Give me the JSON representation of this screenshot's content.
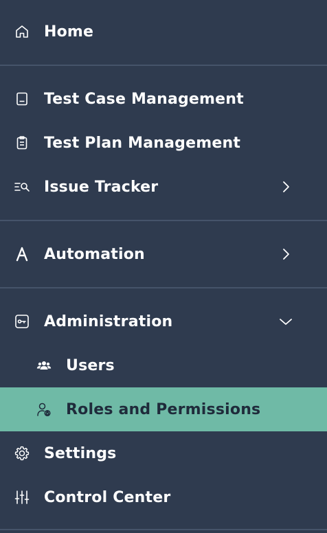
{
  "menu": {
    "home": {
      "label": "Home",
      "icon": "home-icon"
    },
    "test_case_management": {
      "label": "Test Case Management",
      "icon": "test-case-icon"
    },
    "test_plan_management": {
      "label": "Test Plan Management",
      "icon": "clipboard-icon"
    },
    "issue_tracker": {
      "label": "Issue Tracker",
      "icon": "issue-search-icon",
      "expanded": false
    },
    "automation": {
      "label": "Automation",
      "icon": "automation-icon",
      "expanded": false
    },
    "administration": {
      "label": "Administration",
      "icon": "admin-key-icon",
      "expanded": true,
      "children": [
        {
          "label": "Users",
          "icon": "users-icon"
        },
        {
          "label": "Roles and Permissions",
          "icon": "roles-permissions-icon",
          "active": true
        }
      ]
    },
    "settings": {
      "label": "Settings",
      "icon": "gear-icon"
    },
    "control_center": {
      "label": "Control Center",
      "icon": "sliders-icon"
    }
  },
  "colors": {
    "background": "#2f3b4f",
    "divider": "#46546a",
    "active_background": "#6fbaa6",
    "text": "#ffffff",
    "active_text": "#1f2b3b"
  }
}
